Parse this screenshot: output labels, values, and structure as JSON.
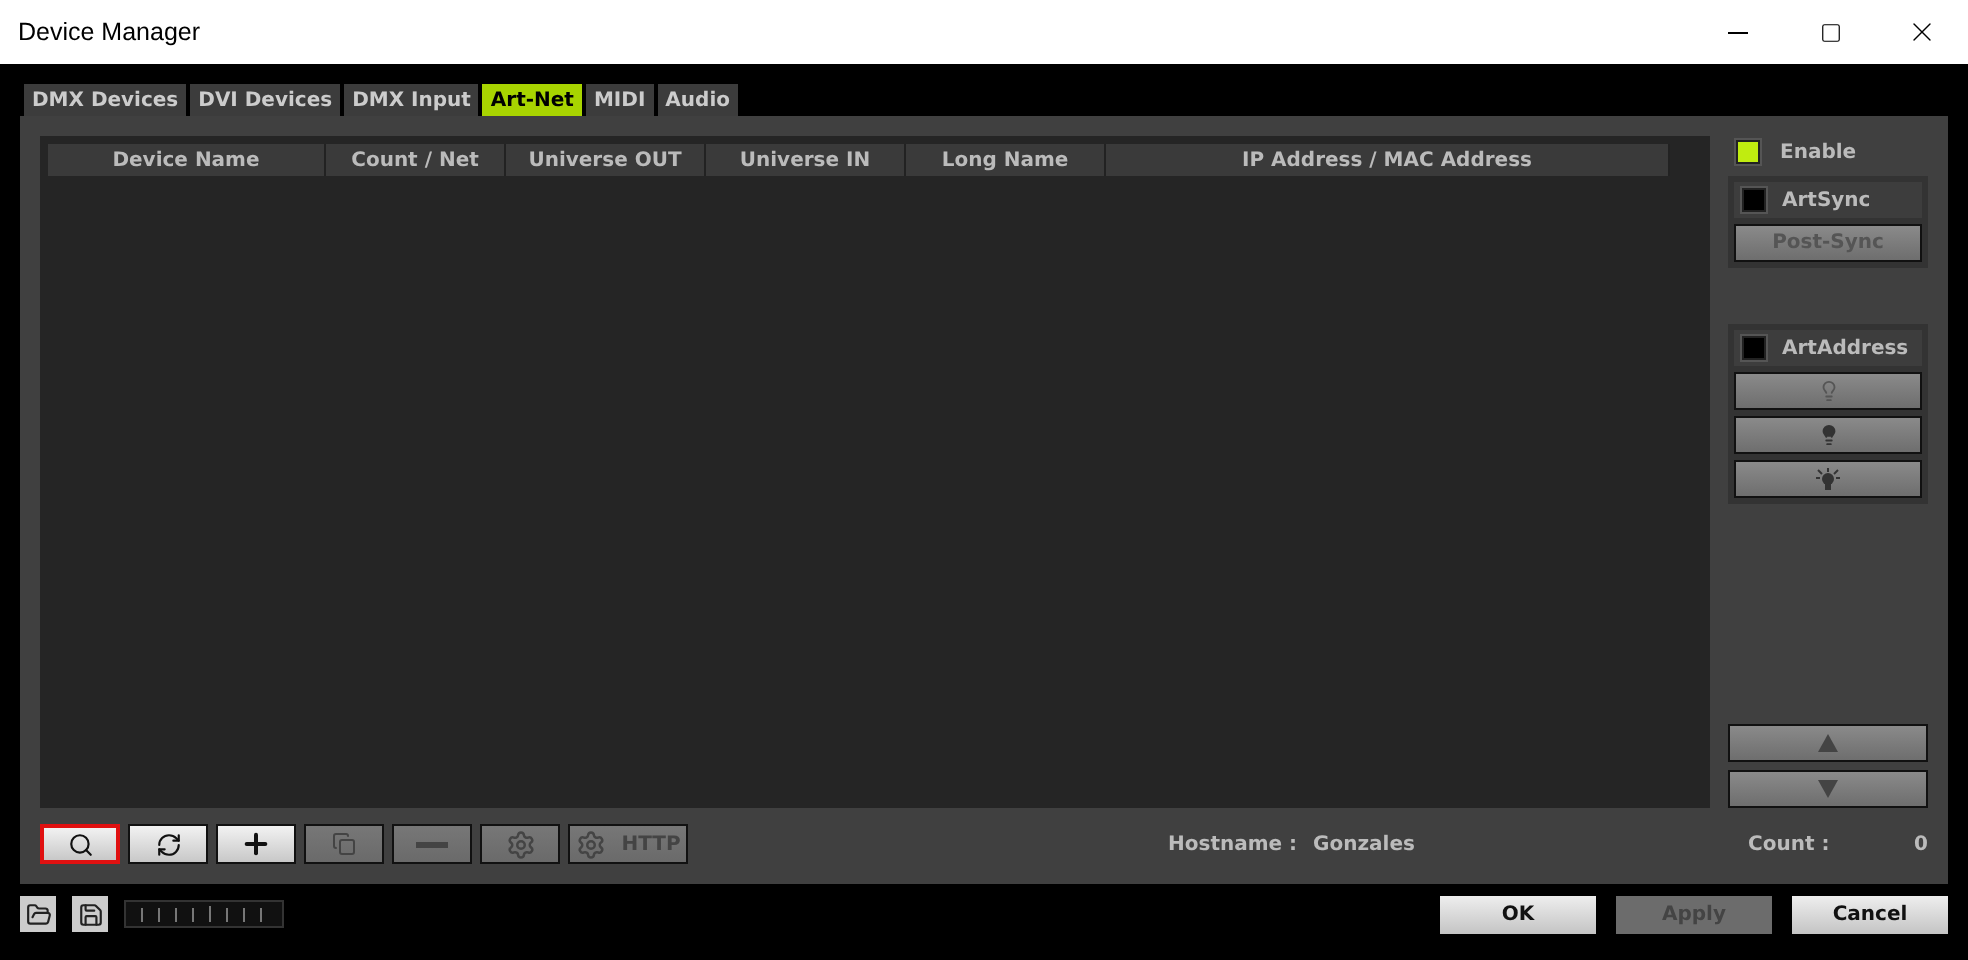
{
  "window": {
    "title": "Device Manager"
  },
  "tabs": [
    {
      "label": "DMX Devices",
      "selected": false
    },
    {
      "label": "DVI Devices",
      "selected": false
    },
    {
      "label": "DMX Input",
      "selected": false
    },
    {
      "label": "Art-Net",
      "selected": true
    },
    {
      "label": "MIDI",
      "selected": false
    },
    {
      "label": "Audio",
      "selected": false
    }
  ],
  "table": {
    "columns": [
      "Device Name",
      "Count / Net",
      "Universe OUT",
      "Universe IN",
      "Long Name",
      "IP Address / MAC Address"
    ]
  },
  "enable": {
    "label": "Enable",
    "checked": true
  },
  "artsync": {
    "label": "ArtSync",
    "checked": false,
    "button": "Post-Sync"
  },
  "artaddress": {
    "label": "ArtAddress",
    "checked": false,
    "buttons": [
      {
        "kind": "bulb-outline"
      },
      {
        "kind": "bulb-filled"
      },
      {
        "kind": "bulb-glow"
      }
    ]
  },
  "order_buttons": [
    {
      "kind": "up"
    },
    {
      "kind": "down"
    }
  ],
  "toolbar": [
    {
      "kind": "search",
      "selected": true,
      "disabled": false
    },
    {
      "kind": "refresh",
      "selected": false,
      "disabled": false
    },
    {
      "kind": "add",
      "selected": false,
      "disabled": false
    },
    {
      "kind": "copy",
      "selected": false,
      "disabled": true
    },
    {
      "kind": "remove",
      "selected": false,
      "disabled": true
    },
    {
      "kind": "gear",
      "selected": false,
      "disabled": true
    },
    {
      "kind": "http",
      "label": "HTTP",
      "selected": false,
      "disabled": true
    }
  ],
  "status": {
    "hostname_label": "Hostname :",
    "hostname": "Gonzales",
    "count_label": "Count :",
    "count": "0"
  },
  "footer_buttons": [
    {
      "label": "OK",
      "disabled": false
    },
    {
      "label": "Apply",
      "disabled": true
    },
    {
      "label": "Cancel",
      "disabled": false
    }
  ]
}
